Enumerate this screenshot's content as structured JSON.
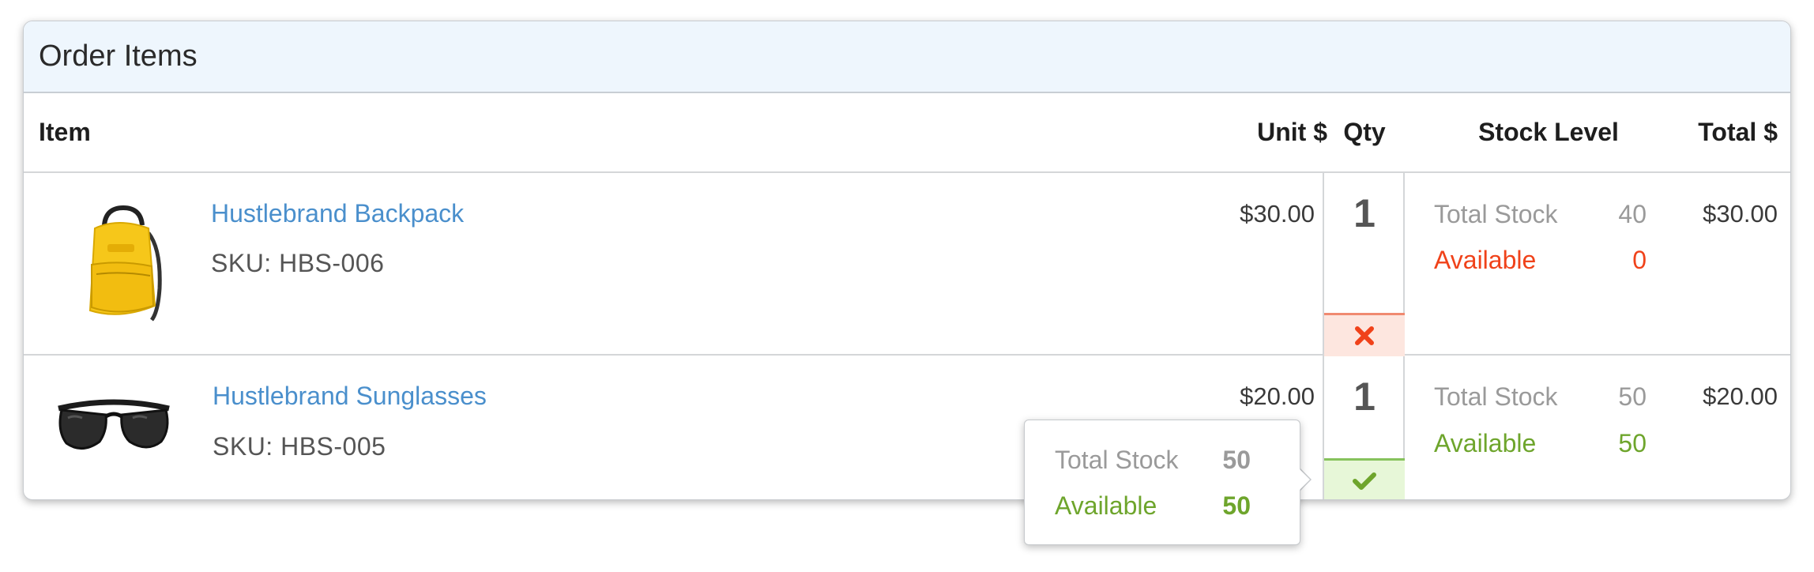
{
  "panel": {
    "title": "Order Items"
  },
  "columns": {
    "item": "Item",
    "unit": "Unit $",
    "qty": "Qty",
    "stock": "Stock Level",
    "total": "Total $"
  },
  "rows": [
    {
      "name": "Hustlebrand Backpack",
      "sku": "SKU: HBS-006",
      "unit_price": "$30.00",
      "qty": "1",
      "total_stock_label": "Total Stock",
      "total_stock": "40",
      "available_label": "Available",
      "available": "0",
      "total": "$30.00",
      "status": "out-of-stock",
      "status_icon": "x-icon",
      "image_icon": "backpack-image"
    },
    {
      "name": "Hustlebrand Sunglasses",
      "sku": "SKU: HBS-005",
      "unit_price": "$20.00",
      "qty": "1",
      "total_stock_label": "Total Stock",
      "total_stock": "50",
      "available_label": "Available",
      "available": "50",
      "total": "$20.00",
      "status": "in-stock",
      "status_icon": "check-icon",
      "image_icon": "sunglasses-image"
    }
  ],
  "tooltip": {
    "total_stock_label": "Total Stock",
    "total_stock": "50",
    "available_label": "Available",
    "available": "50"
  },
  "colors": {
    "link": "#4a8fcc",
    "error": "#f0421a",
    "success": "#6ea52c",
    "header_bg": "#eef6fd"
  }
}
